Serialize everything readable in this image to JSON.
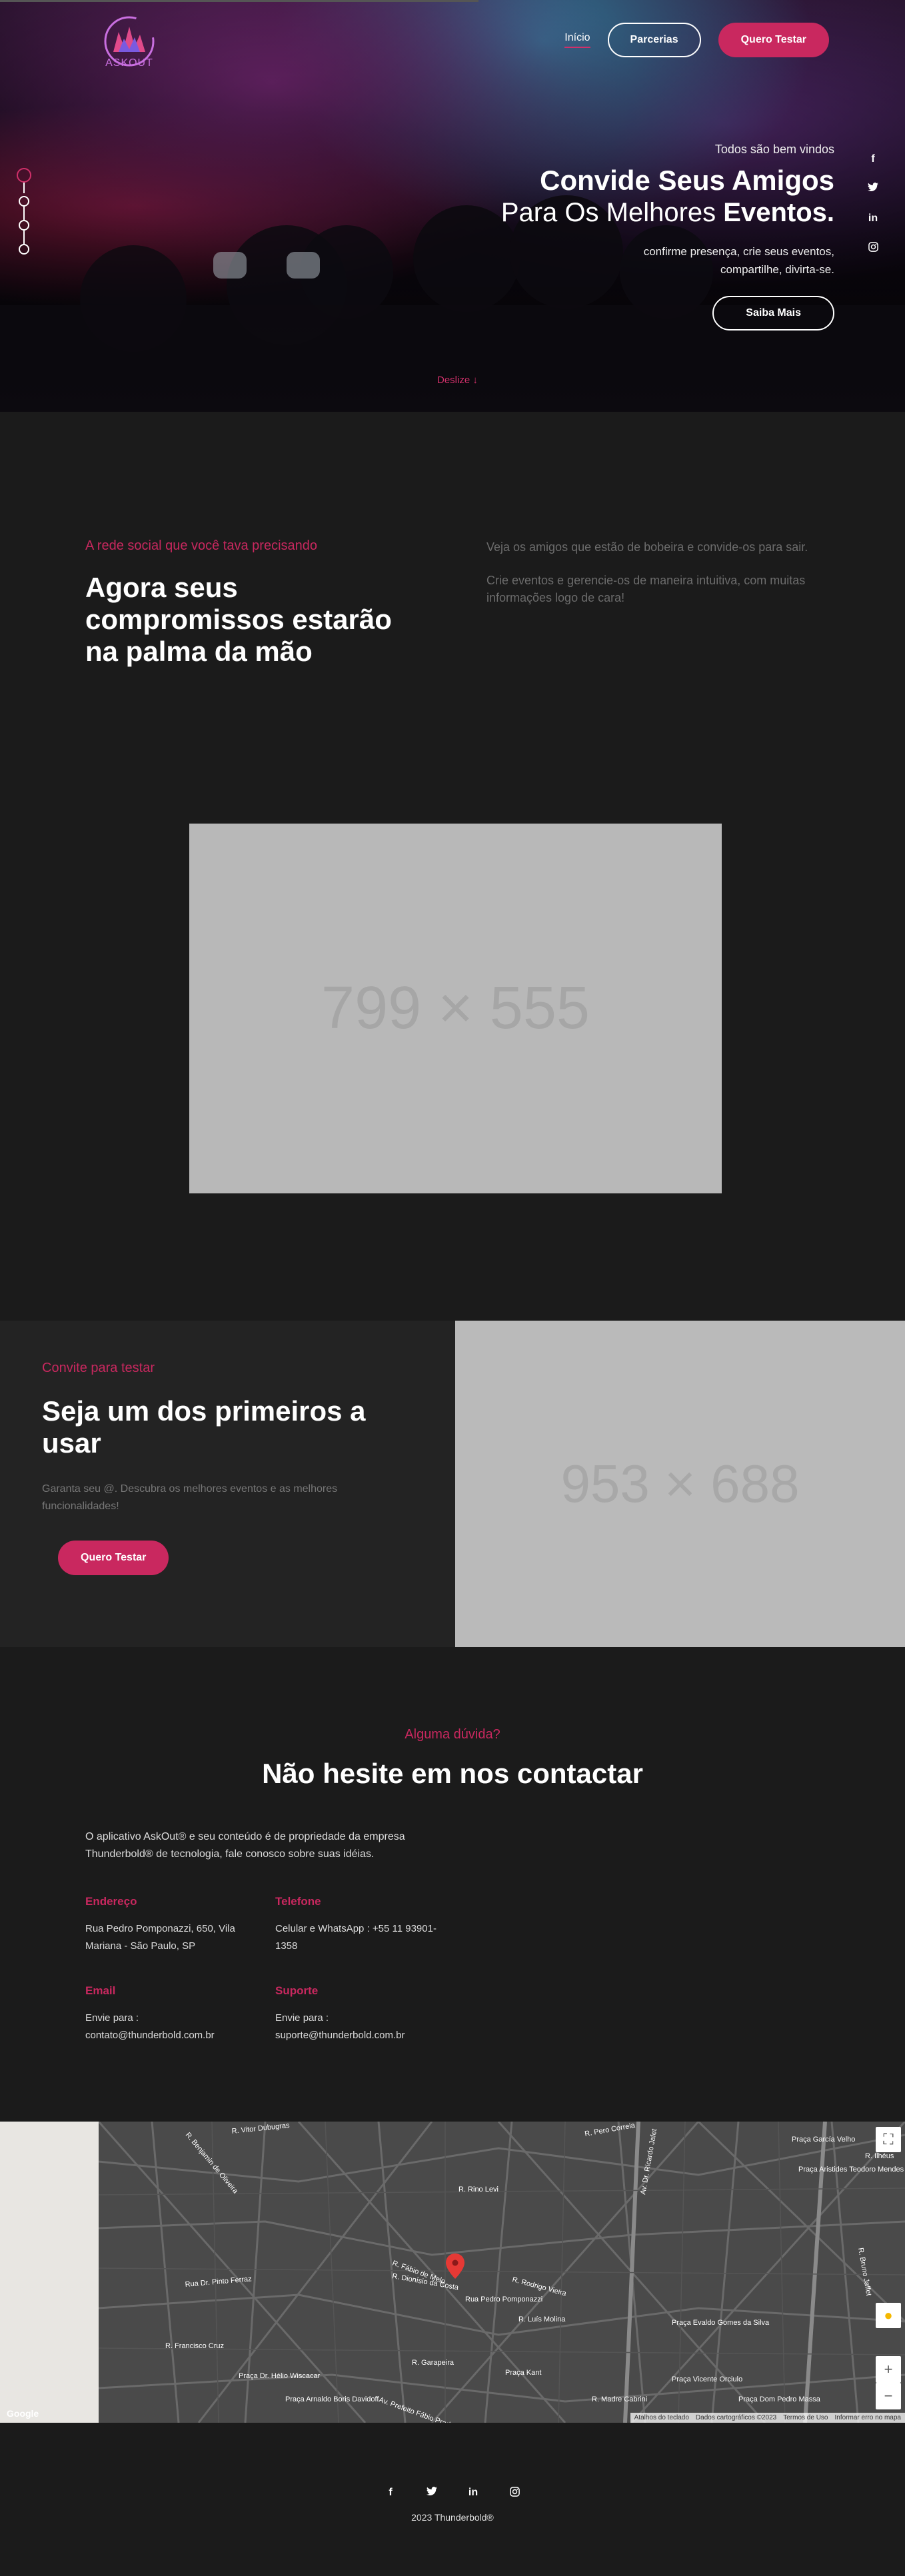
{
  "header": {
    "logo_text": "ASKOUT",
    "nav": {
      "home": "Início",
      "partners": "Parcerias",
      "try": "Quero Testar"
    }
  },
  "hero": {
    "welcome": "Todos são bem vindos",
    "line1": "Convide Seus Amigos",
    "line2_light": "Para Os Melhores",
    "line2_bold": "Eventos.",
    "subtitle_1": "confirme presença, crie seus eventos,",
    "subtitle_2": "compartilhe, divirta-se.",
    "cta": "Saiba Mais",
    "scroll": "Deslize",
    "social": [
      "f",
      "t",
      "in",
      "ig"
    ]
  },
  "about": {
    "kicker": "A rede social que você tava precisando",
    "title": "Agora seus compromissos estarão na palma da mão",
    "p1": "Veja os amigos que estão de bobeira e convide-os para sair.",
    "p2": "Crie eventos e gerencie-os de maneira intuitiva, com muitas informações logo de cara!",
    "placeholder": "799 × 555"
  },
  "invite": {
    "kicker": "Convite para testar",
    "title": "Seja um dos primeiros a usar",
    "text": "Garanta seu @. Descubra os melhores eventos e as melhores funcionalidades!",
    "cta": "Quero Testar",
    "placeholder": "953 × 688"
  },
  "contact": {
    "kicker": "Alguma dúvida?",
    "title": "Não hesite em nos contactar",
    "intro": "O aplicativo AskOut® e seu conteúdo é de propriedade da empresa Thunderbold® de tecnologia, fale conosco sobre suas idéias.",
    "address_head": "Endereço",
    "address": "Rua Pedro Pomponazzi, 650, Vila Mariana - São Paulo, SP",
    "phone_head": "Telefone",
    "phone": "Celular e WhatsApp : +55 11 93901-1358",
    "email_head": "Email",
    "email_label": "Envie para :",
    "email": "contato@thunderbold.com.br",
    "support_head": "Suporte",
    "support_label": "Envie para :",
    "support": "suporte@thunderbold.com.br"
  },
  "map": {
    "streets": [
      "R. Vitor Dubugras",
      "R. Pero Correia",
      "Av. Dr. Ricardo Jafet",
      "Praça García Velho",
      "R. Ilhéus",
      "Praça Aristides Teodoro Mendes",
      "R. Bruno Jaffet",
      "R. Rino Levi",
      "R. Fábio de Melo",
      "R. Dionísio da Costa",
      "Rua Pedro Pomponazzi",
      "R. Rodrigo Vieira",
      "R. Luís Molina",
      "Praça Kant",
      "Praça Evaldo Gomes da Silva",
      "Praça Vicente Orciulo",
      "Praça Dom Pedro Massa",
      "Praça Dr. Hélio Wiscacar",
      "Praça Arnaldo Boris Davidoff",
      "R. Francisco Cruz",
      "R. Benjamin de Oliveira",
      "Rua Dr. Pinto Ferraz",
      "R. Garapeira",
      "Av. Prefeito Fábio Prado",
      "R. Madre Cabrini"
    ],
    "footer_items": [
      "Atalhos do teclado",
      "Dados cartográficos ©2023",
      "Termos de Uso",
      "Informar erro no mapa"
    ],
    "google": "Google"
  },
  "footer": {
    "social": [
      "f",
      "t",
      "in",
      "ig"
    ],
    "copyright": "2023 Thunderbold®"
  },
  "colors": {
    "accent": "#c9285f",
    "bg": "#1b1b1b",
    "panel": "#232323"
  }
}
